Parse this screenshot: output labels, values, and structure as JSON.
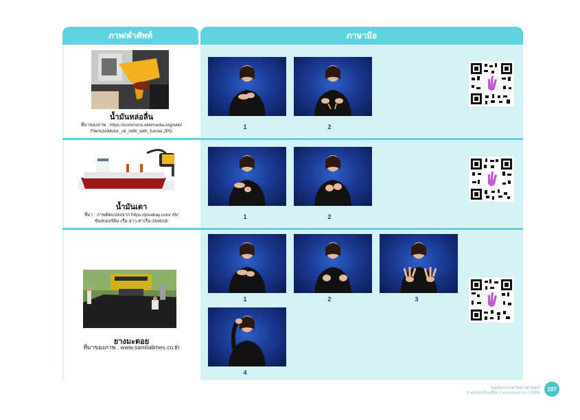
{
  "header": {
    "left": "ภาพ/คำศัพท์",
    "right": "ภาษามือ"
  },
  "rows": [
    {
      "word": "น้ำมันหล่อลื่น",
      "source_line1": "ที่มาของภาพ : https://commons.wikimedia.org/wiki/",
      "source_line2": "File%3AMotor_oil_refill_with_funnel.JPG",
      "steps": [
        "1",
        "2"
      ]
    },
    {
      "word": "น้ำมันเตา",
      "source_line1": "ที่มา : ภาพตัดแปลงจาก https://pixabay.com/ /th/",
      "source_line2": "ขันสเตอร์ติม-เรือ-อ่าว-ท่าเรือ-164818/",
      "steps": [
        "1",
        "2"
      ]
    },
    {
      "word": "ยางมะตอย",
      "source_line1": "ที่มาของภาพ : www.samilatimes.co.th",
      "source_line2": "",
      "steps": [
        "1",
        "2",
        "3",
        "4"
      ]
    }
  ],
  "footer": {
    "title": "ชุดคิดกรรมวิทยาศาสตร์",
    "subtitle": "สำหรับนักเรียนที่มีความบกพร่องทางการได้ยิน",
    "page": "197"
  },
  "colors": {
    "header": "#5ed3de",
    "panel": "#d4f1f5",
    "sign_bg": "#1a3a94",
    "number": "#1a3a8a"
  }
}
